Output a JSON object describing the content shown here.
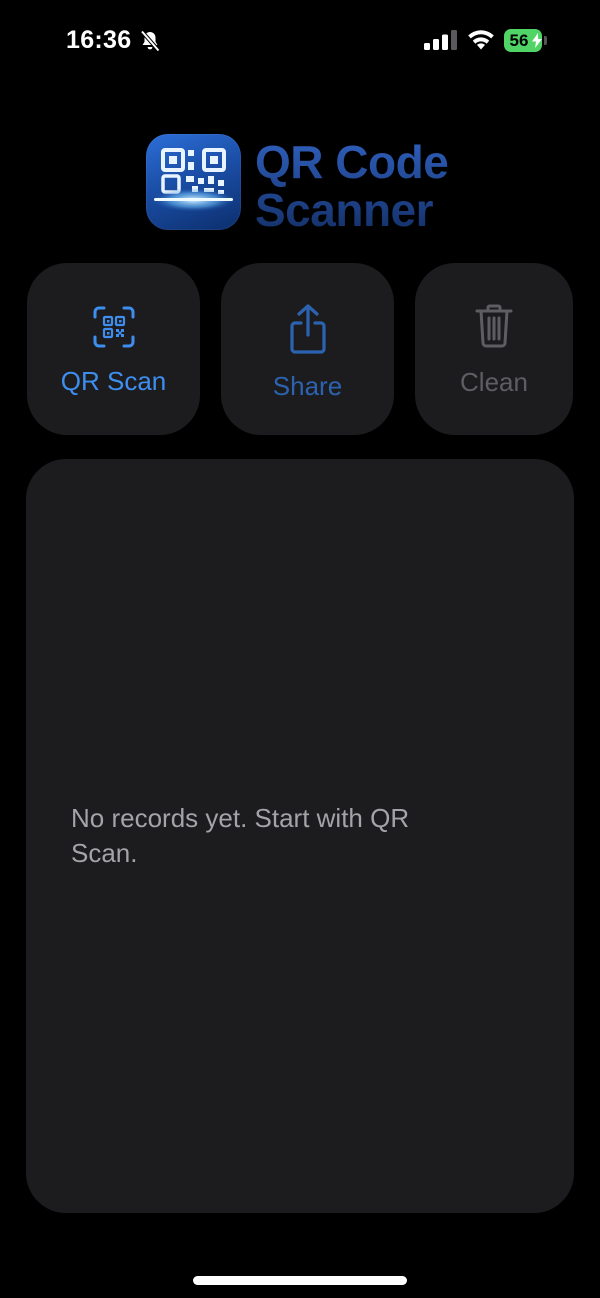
{
  "status_bar": {
    "time": "16:36",
    "battery_level": "56",
    "icons": [
      "bell-slash-icon",
      "cellular-signal-icon",
      "wifi-icon",
      "battery-charging-icon"
    ]
  },
  "header": {
    "title_line1": "QR Code",
    "title_line2": "Scanner",
    "logo_icon": "qr-code-scanner-app-icon"
  },
  "actions": {
    "scan": {
      "label": "QR Scan",
      "icon": "qr-scan-icon",
      "color": "#3e8ef0"
    },
    "share": {
      "label": "Share",
      "icon": "share-icon",
      "color": "#2c63b0"
    },
    "clean": {
      "label": "Clean",
      "icon": "trash-icon",
      "color": "#5e5e62"
    }
  },
  "records": {
    "empty_message": "No records yet. Start with QR Scan."
  },
  "colors": {
    "background": "#000000",
    "card": "#1c1c1e",
    "accent": "#3e8ef0",
    "battery": "#4fd465"
  }
}
